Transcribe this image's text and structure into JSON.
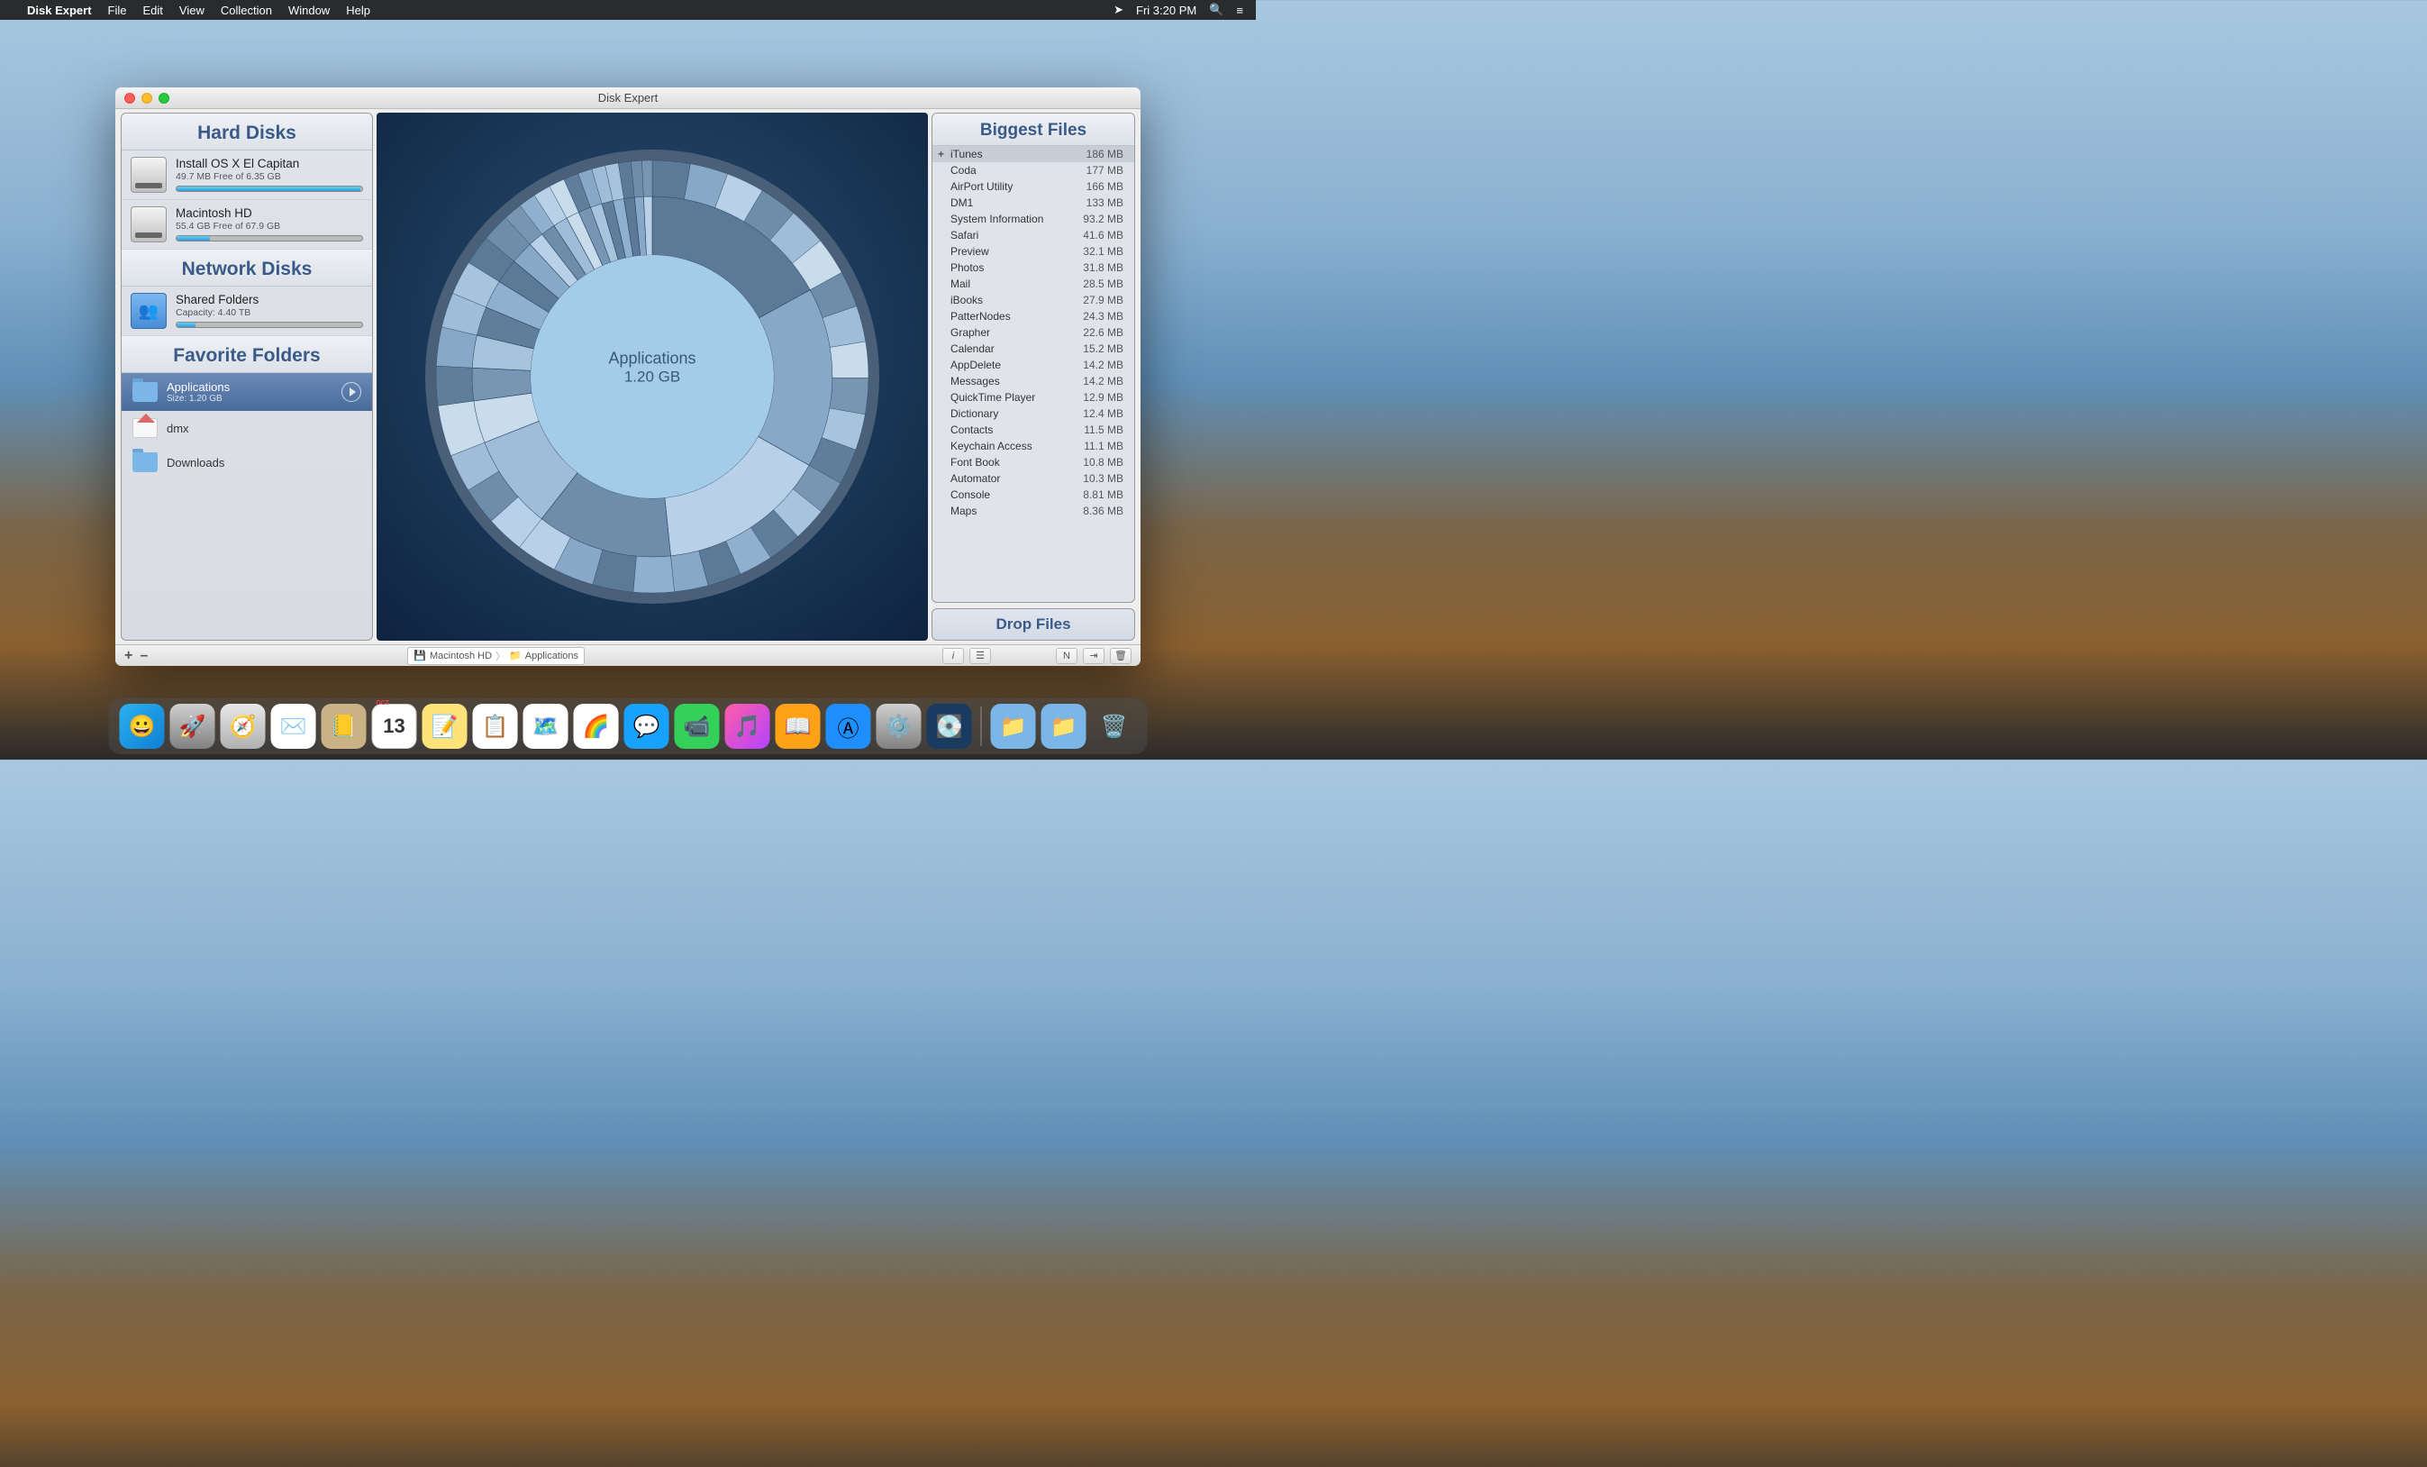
{
  "menubar": {
    "app_name": "Disk Expert",
    "items": [
      "File",
      "Edit",
      "View",
      "Collection",
      "Window",
      "Help"
    ],
    "clock": "Fri 3:20 PM"
  },
  "window": {
    "title": "Disk Expert"
  },
  "sidebar": {
    "hard_disks_header": "Hard Disks",
    "network_disks_header": "Network Disks",
    "favorite_folders_header": "Favorite Folders",
    "hard_disks": [
      {
        "name": "Install OS X El Capitan",
        "free": "49.7 MB Free of 6.35 GB",
        "fill_pct": 99
      },
      {
        "name": "Macintosh HD",
        "free": "55.4 GB Free of 67.9 GB",
        "fill_pct": 18
      }
    ],
    "network_disks": [
      {
        "name": "Shared Folders",
        "free": "Capacity: 4.40 TB",
        "fill_pct": 10
      }
    ],
    "favorites": [
      {
        "name": "Applications",
        "sub": "Size: 1.20 GB",
        "selected": true,
        "icon": "folder",
        "show_play": true
      },
      {
        "name": "dmx",
        "sub": "",
        "selected": false,
        "icon": "home",
        "show_play": false
      },
      {
        "name": "Downloads",
        "sub": "",
        "selected": false,
        "icon": "folder",
        "show_play": false
      }
    ]
  },
  "chart": {
    "center_name": "Applications",
    "center_size": "1.20 GB"
  },
  "chart_data": {
    "type": "sunburst",
    "center": {
      "label": "Applications",
      "size_label": "1.20 GB",
      "size_mb": 1200
    },
    "title": "",
    "children": [
      {
        "name": "iTunes",
        "size_mb": 186
      },
      {
        "name": "Coda",
        "size_mb": 177
      },
      {
        "name": "AirPort Utility",
        "size_mb": 166
      },
      {
        "name": "DM1",
        "size_mb": 133
      },
      {
        "name": "System Information",
        "size_mb": 93.2
      },
      {
        "name": "Safari",
        "size_mb": 41.6
      },
      {
        "name": "Preview",
        "size_mb": 32.1
      },
      {
        "name": "Photos",
        "size_mb": 31.8
      },
      {
        "name": "Mail",
        "size_mb": 28.5
      },
      {
        "name": "iBooks",
        "size_mb": 27.9
      },
      {
        "name": "PatterNodes",
        "size_mb": 24.3
      },
      {
        "name": "Grapher",
        "size_mb": 22.6
      },
      {
        "name": "Calendar",
        "size_mb": 15.2
      },
      {
        "name": "AppDelete",
        "size_mb": 14.2
      },
      {
        "name": "Messages",
        "size_mb": 14.2
      },
      {
        "name": "QuickTime Player",
        "size_mb": 12.9
      },
      {
        "name": "Dictionary",
        "size_mb": 12.4
      },
      {
        "name": "Contacts",
        "size_mb": 11.5
      },
      {
        "name": "Keychain Access",
        "size_mb": 11.1
      },
      {
        "name": "Font Book",
        "size_mb": 10.8
      },
      {
        "name": "Automator",
        "size_mb": 10.3
      },
      {
        "name": "Console",
        "size_mb": 8.81
      },
      {
        "name": "Maps",
        "size_mb": 8.36
      }
    ]
  },
  "biggest_files": {
    "header": "Biggest Files",
    "items": [
      {
        "name": "iTunes",
        "size": "186 MB",
        "selected": true
      },
      {
        "name": "Coda",
        "size": "177 MB"
      },
      {
        "name": "AirPort Utility",
        "size": "166 MB"
      },
      {
        "name": "DM1",
        "size": "133 MB"
      },
      {
        "name": "System Information",
        "size": "93.2 MB"
      },
      {
        "name": "Safari",
        "size": "41.6 MB"
      },
      {
        "name": "Preview",
        "size": "32.1 MB"
      },
      {
        "name": "Photos",
        "size": "31.8 MB"
      },
      {
        "name": "Mail",
        "size": "28.5 MB"
      },
      {
        "name": "iBooks",
        "size": "27.9 MB"
      },
      {
        "name": "PatterNodes",
        "size": "24.3 MB"
      },
      {
        "name": "Grapher",
        "size": "22.6 MB"
      },
      {
        "name": "Calendar",
        "size": "15.2 MB"
      },
      {
        "name": "AppDelete",
        "size": "14.2 MB"
      },
      {
        "name": "Messages",
        "size": "14.2 MB"
      },
      {
        "name": "QuickTime Player",
        "size": "12.9 MB"
      },
      {
        "name": "Dictionary",
        "size": "12.4 MB"
      },
      {
        "name": "Contacts",
        "size": "11.5 MB"
      },
      {
        "name": "Keychain Access",
        "size": "11.1 MB"
      },
      {
        "name": "Font Book",
        "size": "10.8 MB"
      },
      {
        "name": "Automator",
        "size": "10.3 MB"
      },
      {
        "name": "Console",
        "size": "8.81 MB"
      },
      {
        "name": "Maps",
        "size": "8.36 MB"
      }
    ]
  },
  "drop_files_label": "Drop Files",
  "breadcrumb": {
    "disk": "Macintosh HD",
    "folder": "Applications"
  },
  "dock": {
    "items": [
      {
        "name": "finder",
        "emoji": "😀",
        "bg": "linear-gradient(135deg,#2bb1f0,#0f7fd4)"
      },
      {
        "name": "launchpad",
        "emoji": "🚀",
        "bg": "linear-gradient(to bottom,#d0d0d0,#808080)"
      },
      {
        "name": "safari",
        "emoji": "🧭",
        "bg": "linear-gradient(to bottom,#e8e8e8,#b0b0b0)"
      },
      {
        "name": "mail",
        "emoji": "✉️",
        "bg": "#fff"
      },
      {
        "name": "contacts",
        "emoji": "📒",
        "bg": "#c9b285"
      },
      {
        "name": "calendar",
        "emoji": "13",
        "bg": "#fff"
      },
      {
        "name": "notes",
        "emoji": "📝",
        "bg": "#ffe37a"
      },
      {
        "name": "reminders",
        "emoji": "📋",
        "bg": "#fff"
      },
      {
        "name": "maps",
        "emoji": "🗺️",
        "bg": "#fff"
      },
      {
        "name": "photos",
        "emoji": "🌈",
        "bg": "#fff"
      },
      {
        "name": "messages",
        "emoji": "💬",
        "bg": "#17a2ff"
      },
      {
        "name": "facetime",
        "emoji": "📹",
        "bg": "#33d159"
      },
      {
        "name": "itunes",
        "emoji": "🎵",
        "bg": "linear-gradient(135deg,#ff5ca8,#b344ff)"
      },
      {
        "name": "ibooks",
        "emoji": "📖",
        "bg": "#ffa217"
      },
      {
        "name": "appstore",
        "emoji": "Ⓐ",
        "bg": "#1f8fff"
      },
      {
        "name": "preferences",
        "emoji": "⚙️",
        "bg": "linear-gradient(to bottom,#d0d0d0,#808080)"
      },
      {
        "name": "diskexpert",
        "emoji": "💽",
        "bg": "#1a3b60"
      }
    ],
    "right_items": [
      {
        "name": "apps-folder",
        "emoji": "📁",
        "bg": "#7bb6e8"
      },
      {
        "name": "downloads-folder",
        "emoji": "📁",
        "bg": "#7bb6e8"
      },
      {
        "name": "trash",
        "emoji": "🗑️",
        "bg": "transparent"
      }
    ]
  }
}
